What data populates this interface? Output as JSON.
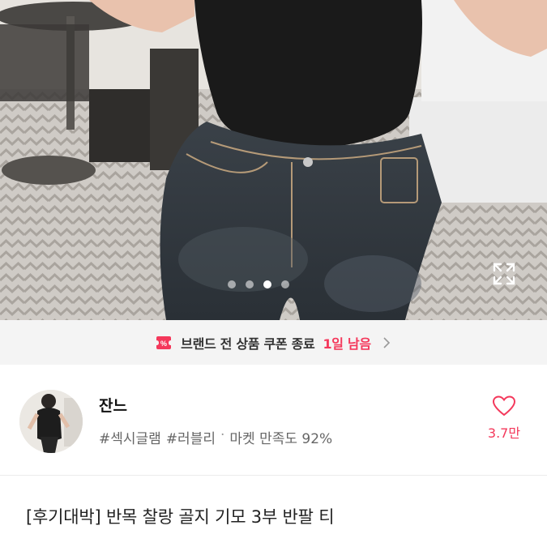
{
  "gallery": {
    "dots": 4,
    "active_index": 2,
    "expand_icon": "expand-icon"
  },
  "coupon": {
    "icon": "coupon-icon",
    "text": "브랜드 전 상품 쿠폰 종료",
    "highlight": "1일 남음",
    "accent": "#f4385b"
  },
  "shop": {
    "name": "잔느",
    "tags": [
      "#섹시글램",
      "#러블리"
    ],
    "separator": "·",
    "satisfaction": "마켓 만족도 92%",
    "like_count": "3.7만",
    "like_icon": "heart-outline-icon"
  },
  "product": {
    "title": "[후기대박] 반목 찰랑 골지 기모 3부 반팔 티"
  }
}
